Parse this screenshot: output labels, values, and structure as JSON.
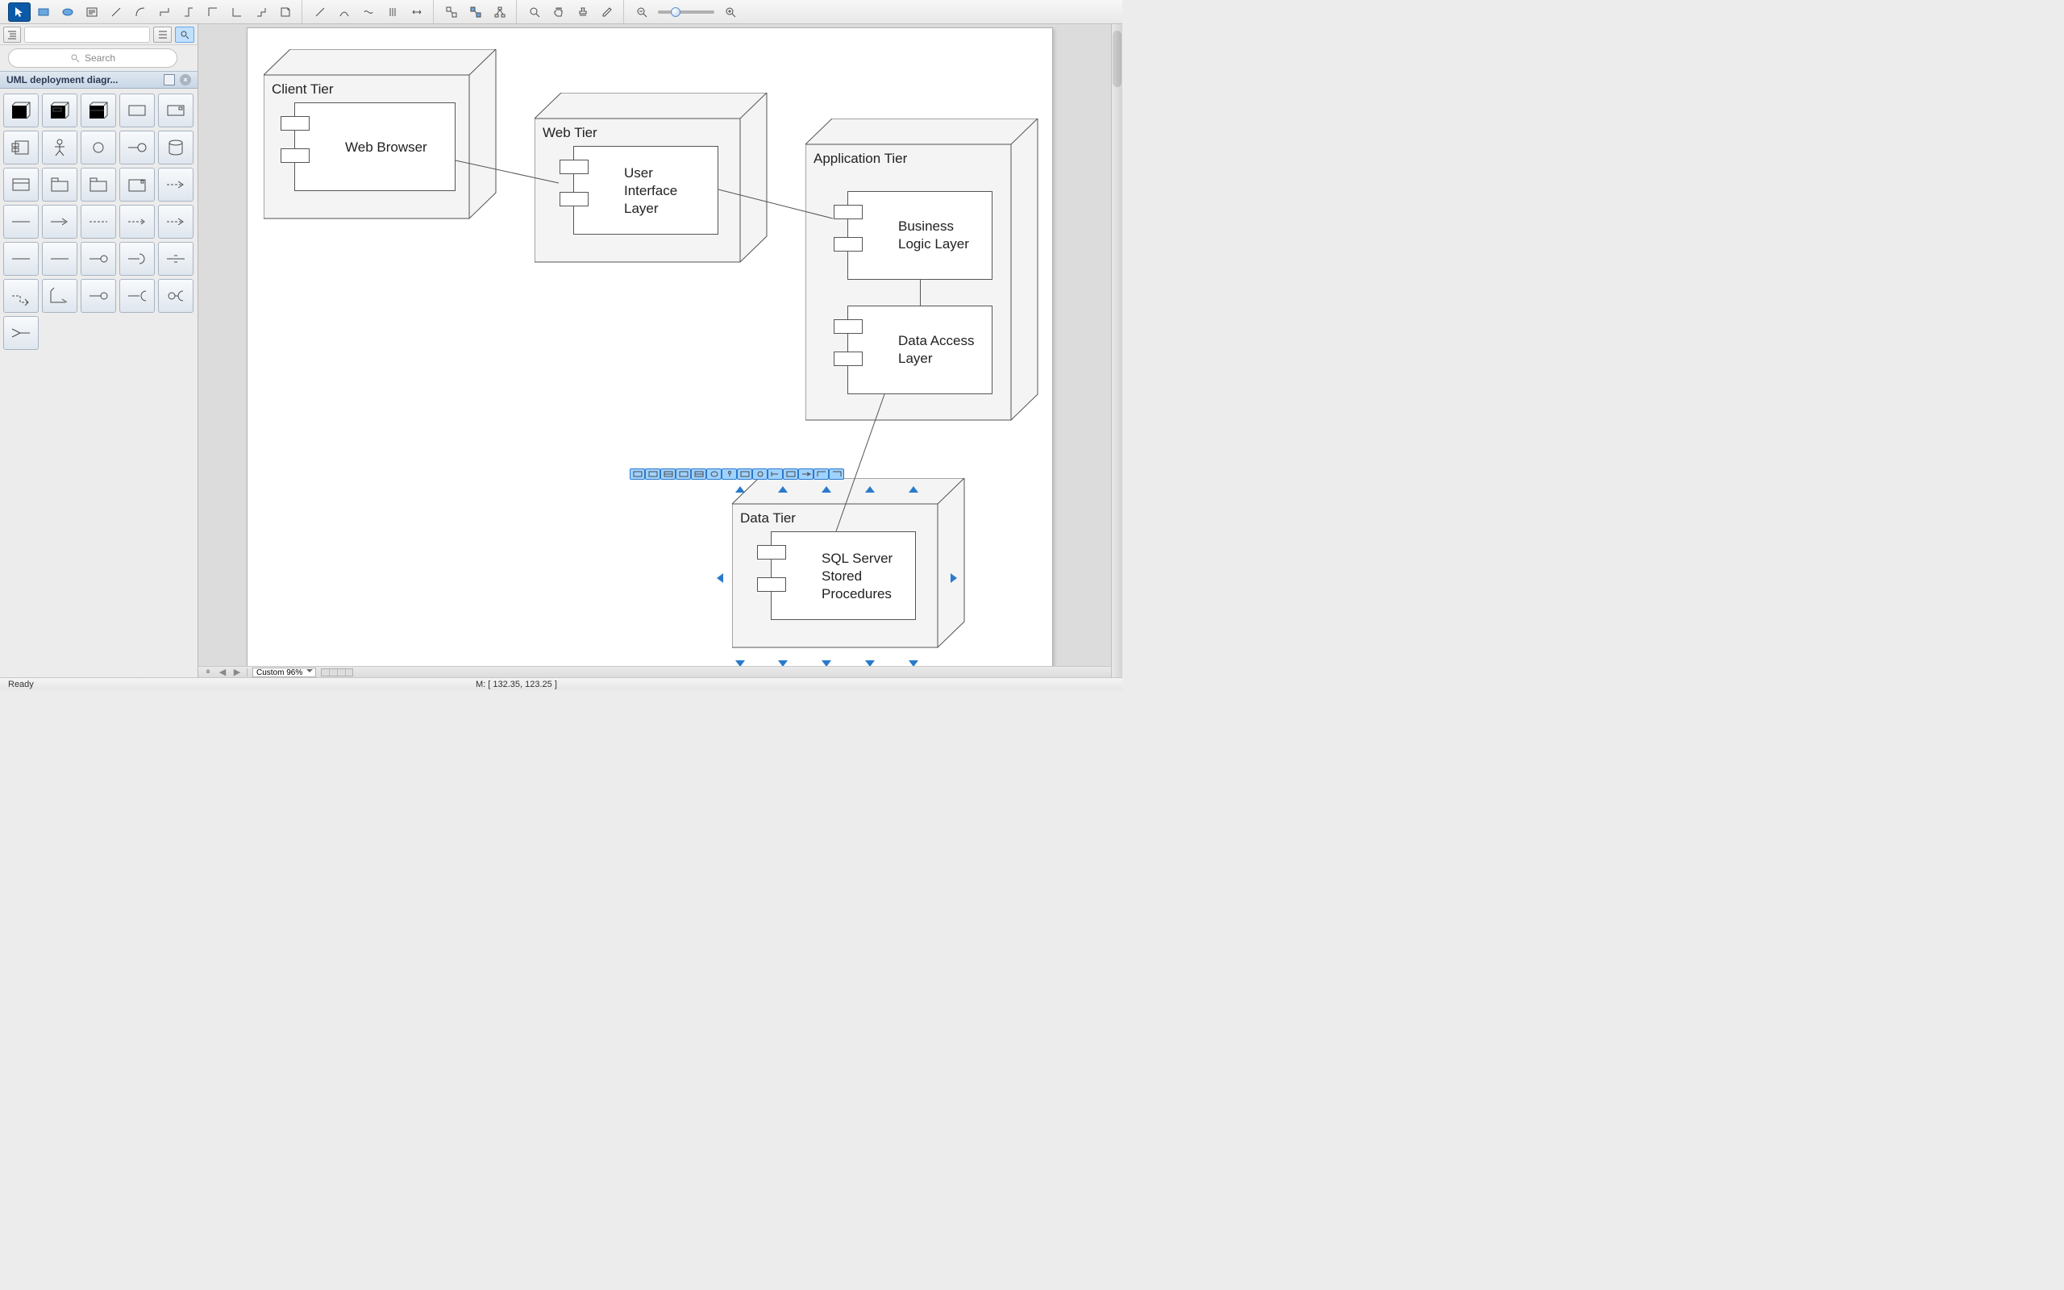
{
  "toolbar": {
    "groups": [
      {
        "items": [
          "pointer",
          "rectangle",
          "ellipse",
          "text",
          "connector-straight",
          "connector-curved",
          "connector-orth-1",
          "connector-orth-2",
          "connector-orth-3",
          "connector-orth-4",
          "connector-orth-5",
          "note"
        ]
      },
      {
        "items": [
          "line-1",
          "line-2",
          "line-3",
          "line-4",
          "line-5"
        ]
      },
      {
        "items": [
          "layout-1",
          "layout-2",
          "layout-3"
        ]
      },
      {
        "items": [
          "zoom-tool",
          "pan-tool",
          "highlight-tool",
          "pencil-tool"
        ]
      }
    ],
    "zoom_out": "-",
    "zoom_in": "+"
  },
  "sidebar": {
    "search_placeholder": "Search",
    "stencil_title": "UML deployment diagr..."
  },
  "diagram": {
    "nodes": {
      "client": {
        "title": "Client Tier",
        "component": "Web Browser"
      },
      "web": {
        "title": "Web Tier",
        "component": "User Interface Layer"
      },
      "app": {
        "title": "Application Tier",
        "component1": "Business Logic Layer",
        "component2": "Data Access Layer"
      },
      "data": {
        "title": "Data Tier",
        "component": "SQL Server Stored Procedures"
      }
    }
  },
  "footer": {
    "zoom": "Custom 96%",
    "mouse_label": "M: [ 132.35, 123.25 ]"
  },
  "status": {
    "ready": "Ready"
  }
}
